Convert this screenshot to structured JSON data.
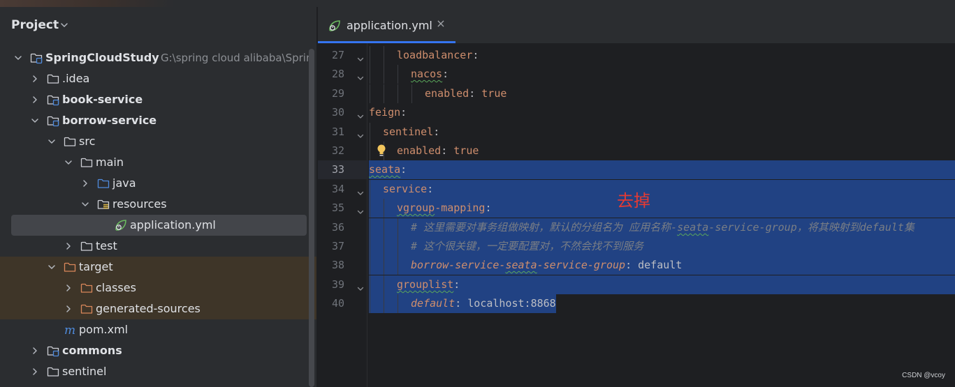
{
  "project_panel": {
    "title": "Project",
    "tree": [
      {
        "label": "SpringCloudStudy",
        "path": "G:\\spring cloud alibaba\\Sprin",
        "bold": true,
        "depth": 0,
        "expanded": true,
        "icon": "module-folder-icon"
      },
      {
        "label": ".idea",
        "bold": false,
        "depth": 1,
        "expanded": false,
        "icon": "folder-icon"
      },
      {
        "label": "book-service",
        "bold": true,
        "depth": 1,
        "expanded": false,
        "icon": "module-folder-icon"
      },
      {
        "label": "borrow-service",
        "bold": true,
        "depth": 1,
        "expanded": true,
        "icon": "module-folder-icon"
      },
      {
        "label": "src",
        "bold": false,
        "depth": 2,
        "expanded": true,
        "icon": "folder-icon"
      },
      {
        "label": "main",
        "bold": false,
        "depth": 3,
        "expanded": true,
        "icon": "folder-icon"
      },
      {
        "label": "java",
        "bold": false,
        "depth": 4,
        "expanded": false,
        "icon": "source-folder-icon"
      },
      {
        "label": "resources",
        "bold": false,
        "depth": 4,
        "expanded": true,
        "icon": "resources-folder-icon"
      },
      {
        "label": "application.yml",
        "bold": false,
        "depth": 5,
        "icon": "spring-leaf-icon",
        "selected": true
      },
      {
        "label": "test",
        "bold": false,
        "depth": 3,
        "expanded": false,
        "icon": "folder-icon"
      },
      {
        "label": "target",
        "bold": false,
        "depth": 2,
        "expanded": true,
        "icon": "excluded-folder-icon",
        "excluded": true
      },
      {
        "label": "classes",
        "bold": false,
        "depth": 3,
        "expanded": false,
        "icon": "excluded-folder-icon",
        "excluded": true
      },
      {
        "label": "generated-sources",
        "bold": false,
        "depth": 3,
        "expanded": false,
        "icon": "excluded-folder-icon",
        "excluded": true
      },
      {
        "label": "pom.xml",
        "bold": false,
        "depth": 2,
        "icon": "maven-icon"
      },
      {
        "label": "commons",
        "bold": true,
        "depth": 1,
        "expanded": false,
        "icon": "module-folder-icon"
      },
      {
        "label": "sentinel",
        "bold": false,
        "depth": 1,
        "expanded": false,
        "icon": "folder-icon"
      }
    ]
  },
  "editor": {
    "tab_label": "application.yml",
    "tab_close": "×",
    "lines": [
      {
        "n": "27",
        "indent": 2,
        "tokens": [
          {
            "t": "loadbalancer",
            "c": "k"
          },
          {
            "t": ":",
            "c": "p"
          }
        ],
        "fold": true
      },
      {
        "n": "28",
        "indent": 3,
        "tokens": [
          {
            "t": "nacos",
            "c": "k",
            "squig": true
          },
          {
            "t": ":",
            "c": "p"
          }
        ],
        "fold": true
      },
      {
        "n": "29",
        "indent": 4,
        "tokens": [
          {
            "t": "enabled",
            "c": "k"
          },
          {
            "t": ": ",
            "c": "p"
          },
          {
            "t": "true",
            "c": "v"
          }
        ]
      },
      {
        "n": "30",
        "indent": 0,
        "tokens": [
          {
            "t": "feign",
            "c": "k"
          },
          {
            "t": ":",
            "c": "p"
          }
        ],
        "fold": true
      },
      {
        "n": "31",
        "indent": 1,
        "tokens": [
          {
            "t": "sentinel",
            "c": "k"
          },
          {
            "t": ":",
            "c": "p"
          }
        ],
        "fold": true
      },
      {
        "n": "32",
        "indent": 2,
        "tokens": [
          {
            "t": "enabled",
            "c": "k"
          },
          {
            "t": ": ",
            "c": "p"
          },
          {
            "t": "true",
            "c": "v"
          }
        ],
        "bulb": true
      },
      {
        "n": "33",
        "indent": 0,
        "tokens": [
          {
            "t": "seata",
            "c": "k",
            "squig": true
          },
          {
            "t": ":",
            "c": "p"
          }
        ],
        "selected": true,
        "current": true
      },
      {
        "n": "34",
        "indent": 1,
        "tokens": [
          {
            "t": "service",
            "c": "k"
          },
          {
            "t": ":",
            "c": "p"
          }
        ],
        "fold": true,
        "selected": true
      },
      {
        "n": "35",
        "indent": 2,
        "tokens": [
          {
            "t": "vgroup",
            "c": "k",
            "squig": true
          },
          {
            "t": "-mapping",
            "c": "k"
          },
          {
            "t": ":",
            "c": "p"
          }
        ],
        "fold": true,
        "selected": true
      },
      {
        "n": "36",
        "indent": 3,
        "tokens": [
          {
            "t": "# 这里需要对事务组做映射，默认的分组名为 应用名称-",
            "c": "cmt"
          },
          {
            "t": "seata",
            "c": "cmt",
            "squig": true
          },
          {
            "t": "-service-group，将其映射到default集",
            "c": "cmt"
          }
        ],
        "selected": true
      },
      {
        "n": "37",
        "indent": 3,
        "tokens": [
          {
            "t": "# 这个很关键，一定要配置对，不然会找不到服务",
            "c": "cmt"
          }
        ],
        "selected": true
      },
      {
        "n": "38",
        "indent": 3,
        "tokens": [
          {
            "t": "borrow-service-",
            "c": "it"
          },
          {
            "t": "seata",
            "c": "it",
            "squig": true
          },
          {
            "t": "-service-group",
            "c": "it"
          },
          {
            "t": ": default",
            "c": "plain"
          }
        ],
        "selected": true
      },
      {
        "n": "39",
        "indent": 2,
        "tokens": [
          {
            "t": "grouplist",
            "c": "k",
            "squig": true
          },
          {
            "t": ":",
            "c": "p"
          }
        ],
        "fold": true,
        "selected": true
      },
      {
        "n": "40",
        "indent": 3,
        "tokens": [
          {
            "t": "default",
            "c": "it"
          },
          {
            "t": ": localhost:8868",
            "c": "plain"
          }
        ],
        "selected": true,
        "partial": true
      }
    ]
  },
  "annotation": "去掉",
  "watermark": "CSDN @vcoy",
  "colors": {
    "selection": "#214283",
    "key": "#cf8e6d",
    "comment": "#7a7e85",
    "annotation": "#e53a33",
    "tab_underline": "#3574f0"
  }
}
